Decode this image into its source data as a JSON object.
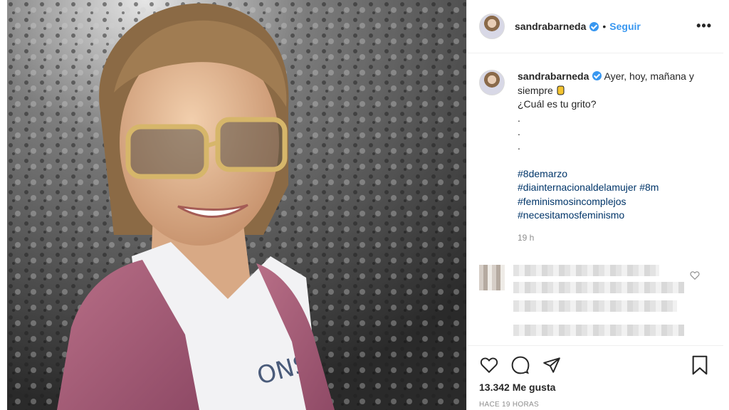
{
  "post": {
    "username": "sandrabarneda",
    "verified": true,
    "follow_label": "Seguir",
    "more_label": "•••",
    "separator": "•"
  },
  "caption": {
    "line1": "Ayer, hoy, mañana y siempre",
    "emoji": "yellow-fist-emoji",
    "line2": "¿Cuál es tu grito?",
    "dots": [
      ".",
      ".",
      "."
    ],
    "hashtags": [
      "#8demarzo",
      "#diainternacionaldelamujer #8m",
      "#feminismosincomplejos",
      "#necesitamosfeminismo"
    ],
    "timestamp": "19 h"
  },
  "comment": {
    "blurred": true
  },
  "actions": {
    "like_icon": "heart-icon",
    "comment_icon": "comment-icon",
    "share_icon": "share-icon",
    "save_icon": "bookmark-icon"
  },
  "likes": "13.342 Me gusta",
  "time_label": "HACE 19 HORAS",
  "colors": {
    "link": "#3897f0",
    "hashtag": "#003569",
    "muted": "#8e8e8e",
    "text": "#262626"
  }
}
